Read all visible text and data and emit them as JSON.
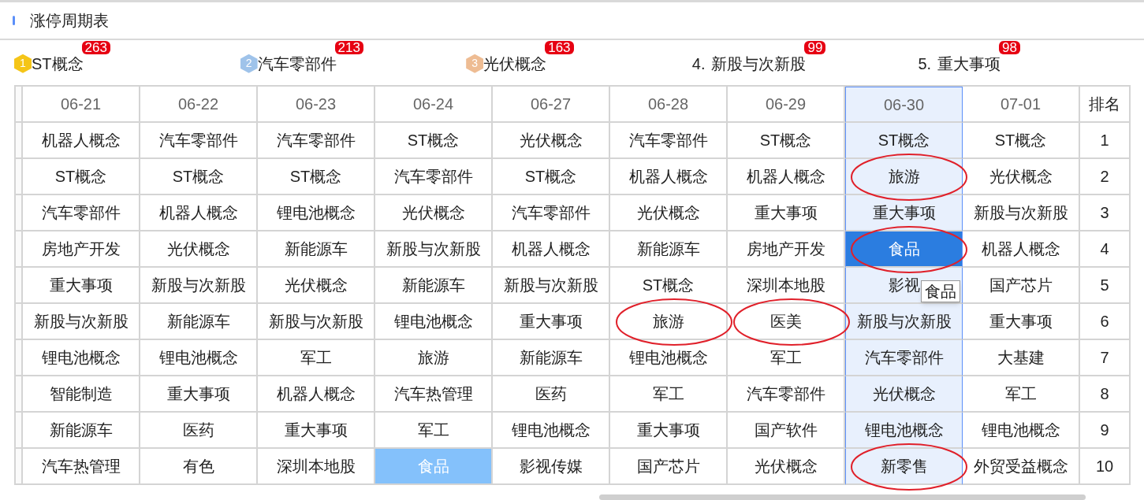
{
  "title": "涨停周期表",
  "legend": [
    {
      "kind": "medal",
      "rank": "1",
      "color": "#f5c518",
      "label": "ST概念",
      "count": "263"
    },
    {
      "kind": "medal",
      "rank": "2",
      "color": "#9fc3ea",
      "label": "汽车零部件",
      "count": "213"
    },
    {
      "kind": "medal",
      "rank": "3",
      "color": "#eebc93",
      "label": "光伏概念",
      "count": "163"
    },
    {
      "kind": "plain",
      "rank": "4.",
      "label": "新股与次新股",
      "count": "99"
    },
    {
      "kind": "plain",
      "rank": "5.",
      "label": "重大事项",
      "count": "98"
    }
  ],
  "table": {
    "columns": [
      {
        "label": "06-21",
        "selected": false
      },
      {
        "label": "06-22",
        "selected": false
      },
      {
        "label": "06-23",
        "selected": false
      },
      {
        "label": "06-24",
        "selected": false
      },
      {
        "label": "06-27",
        "selected": false
      },
      {
        "label": "06-28",
        "selected": false
      },
      {
        "label": "06-29",
        "selected": false
      },
      {
        "label": "06-30",
        "selected": true
      },
      {
        "label": "07-01",
        "selected": false
      }
    ],
    "rank_header": "排名",
    "rows": [
      {
        "rank": "1",
        "cells": [
          {
            "text": "机器人概念",
            "selected": false,
            "highlighted": false,
            "circled": false
          },
          {
            "text": "汽车零部件",
            "selected": false,
            "highlighted": false,
            "circled": false
          },
          {
            "text": "汽车零部件",
            "selected": false,
            "highlighted": false,
            "circled": false
          },
          {
            "text": "ST概念",
            "selected": false,
            "highlighted": false,
            "circled": false
          },
          {
            "text": "光伏概念",
            "selected": false,
            "highlighted": false,
            "circled": false
          },
          {
            "text": "汽车零部件",
            "selected": false,
            "highlighted": false,
            "circled": false
          },
          {
            "text": "ST概念",
            "selected": false,
            "highlighted": false,
            "circled": false
          },
          {
            "text": "ST概念",
            "selected": false,
            "highlighted": false,
            "circled": false
          },
          {
            "text": "ST概念",
            "selected": false,
            "highlighted": false,
            "circled": false
          }
        ]
      },
      {
        "rank": "2",
        "cells": [
          {
            "text": "ST概念",
            "selected": false,
            "highlighted": false,
            "circled": false
          },
          {
            "text": "ST概念",
            "selected": false,
            "highlighted": false,
            "circled": false
          },
          {
            "text": "ST概念",
            "selected": false,
            "highlighted": false,
            "circled": false
          },
          {
            "text": "汽车零部件",
            "selected": false,
            "highlighted": false,
            "circled": false
          },
          {
            "text": "ST概念",
            "selected": false,
            "highlighted": false,
            "circled": false
          },
          {
            "text": "机器人概念",
            "selected": false,
            "highlighted": false,
            "circled": false
          },
          {
            "text": "机器人概念",
            "selected": false,
            "highlighted": false,
            "circled": false
          },
          {
            "text": "旅游",
            "selected": false,
            "highlighted": false,
            "circled": true
          },
          {
            "text": "光伏概念",
            "selected": false,
            "highlighted": false,
            "circled": false
          }
        ]
      },
      {
        "rank": "3",
        "cells": [
          {
            "text": "汽车零部件",
            "selected": false,
            "highlighted": false,
            "circled": false
          },
          {
            "text": "机器人概念",
            "selected": false,
            "highlighted": false,
            "circled": false
          },
          {
            "text": "锂电池概念",
            "selected": false,
            "highlighted": false,
            "circled": false
          },
          {
            "text": "光伏概念",
            "selected": false,
            "highlighted": false,
            "circled": false
          },
          {
            "text": "汽车零部件",
            "selected": false,
            "highlighted": false,
            "circled": false
          },
          {
            "text": "光伏概念",
            "selected": false,
            "highlighted": false,
            "circled": false
          },
          {
            "text": "重大事项",
            "selected": false,
            "highlighted": false,
            "circled": false
          },
          {
            "text": "重大事项",
            "selected": false,
            "highlighted": false,
            "circled": false
          },
          {
            "text": "新股与次新股",
            "selected": false,
            "highlighted": false,
            "circled": false
          }
        ]
      },
      {
        "rank": "4",
        "cells": [
          {
            "text": "房地产开发",
            "selected": false,
            "highlighted": false,
            "circled": false
          },
          {
            "text": "光伏概念",
            "selected": false,
            "highlighted": false,
            "circled": false
          },
          {
            "text": "新能源车",
            "selected": false,
            "highlighted": false,
            "circled": false
          },
          {
            "text": "新股与次新股",
            "selected": false,
            "highlighted": false,
            "circled": false
          },
          {
            "text": "机器人概念",
            "selected": false,
            "highlighted": false,
            "circled": false
          },
          {
            "text": "新能源车",
            "selected": false,
            "highlighted": false,
            "circled": false
          },
          {
            "text": "房地产开发",
            "selected": false,
            "highlighted": false,
            "circled": false
          },
          {
            "text": "食品",
            "selected": true,
            "highlighted": false,
            "circled": true
          },
          {
            "text": "机器人概念",
            "selected": false,
            "highlighted": false,
            "circled": false
          }
        ]
      },
      {
        "rank": "5",
        "cells": [
          {
            "text": "重大事项",
            "selected": false,
            "highlighted": false,
            "circled": false
          },
          {
            "text": "新股与次新股",
            "selected": false,
            "highlighted": false,
            "circled": false
          },
          {
            "text": "光伏概念",
            "selected": false,
            "highlighted": false,
            "circled": false
          },
          {
            "text": "新能源车",
            "selected": false,
            "highlighted": false,
            "circled": false
          },
          {
            "text": "新股与次新股",
            "selected": false,
            "highlighted": false,
            "circled": false
          },
          {
            "text": "ST概念",
            "selected": false,
            "highlighted": false,
            "circled": false
          },
          {
            "text": "深圳本地股",
            "selected": false,
            "highlighted": false,
            "circled": false
          },
          {
            "text": "影视",
            "selected": false,
            "highlighted": false,
            "circled": false,
            "tooltip": "食品"
          },
          {
            "text": "国产芯片",
            "selected": false,
            "highlighted": false,
            "circled": false
          }
        ]
      },
      {
        "rank": "6",
        "cells": [
          {
            "text": "新股与次新股",
            "selected": false,
            "highlighted": false,
            "circled": false
          },
          {
            "text": "新能源车",
            "selected": false,
            "highlighted": false,
            "circled": false
          },
          {
            "text": "新股与次新股",
            "selected": false,
            "highlighted": false,
            "circled": false
          },
          {
            "text": "锂电池概念",
            "selected": false,
            "highlighted": false,
            "circled": false
          },
          {
            "text": "重大事项",
            "selected": false,
            "highlighted": false,
            "circled": false
          },
          {
            "text": "旅游",
            "selected": false,
            "highlighted": false,
            "circled": true
          },
          {
            "text": "医美",
            "selected": false,
            "highlighted": false,
            "circled": true
          },
          {
            "text": "新股与次新股",
            "selected": false,
            "highlighted": false,
            "circled": false
          },
          {
            "text": "重大事项",
            "selected": false,
            "highlighted": false,
            "circled": false
          }
        ]
      },
      {
        "rank": "7",
        "cells": [
          {
            "text": "锂电池概念",
            "selected": false,
            "highlighted": false,
            "circled": false
          },
          {
            "text": "锂电池概念",
            "selected": false,
            "highlighted": false,
            "circled": false
          },
          {
            "text": "军工",
            "selected": false,
            "highlighted": false,
            "circled": false
          },
          {
            "text": "旅游",
            "selected": false,
            "highlighted": false,
            "circled": false
          },
          {
            "text": "新能源车",
            "selected": false,
            "highlighted": false,
            "circled": false
          },
          {
            "text": "锂电池概念",
            "selected": false,
            "highlighted": false,
            "circled": false
          },
          {
            "text": "军工",
            "selected": false,
            "highlighted": false,
            "circled": false
          },
          {
            "text": "汽车零部件",
            "selected": false,
            "highlighted": false,
            "circled": false
          },
          {
            "text": "大基建",
            "selected": false,
            "highlighted": false,
            "circled": false
          }
        ]
      },
      {
        "rank": "8",
        "cells": [
          {
            "text": "智能制造",
            "selected": false,
            "highlighted": false,
            "circled": false
          },
          {
            "text": "重大事项",
            "selected": false,
            "highlighted": false,
            "circled": false
          },
          {
            "text": "机器人概念",
            "selected": false,
            "highlighted": false,
            "circled": false
          },
          {
            "text": "汽车热管理",
            "selected": false,
            "highlighted": false,
            "circled": false
          },
          {
            "text": "医药",
            "selected": false,
            "highlighted": false,
            "circled": false
          },
          {
            "text": "军工",
            "selected": false,
            "highlighted": false,
            "circled": false
          },
          {
            "text": "汽车零部件",
            "selected": false,
            "highlighted": false,
            "circled": false
          },
          {
            "text": "光伏概念",
            "selected": false,
            "highlighted": false,
            "circled": false
          },
          {
            "text": "军工",
            "selected": false,
            "highlighted": false,
            "circled": false
          }
        ]
      },
      {
        "rank": "9",
        "cells": [
          {
            "text": "新能源车",
            "selected": false,
            "highlighted": false,
            "circled": false
          },
          {
            "text": "医药",
            "selected": false,
            "highlighted": false,
            "circled": false
          },
          {
            "text": "重大事项",
            "selected": false,
            "highlighted": false,
            "circled": false
          },
          {
            "text": "军工",
            "selected": false,
            "highlighted": false,
            "circled": false
          },
          {
            "text": "锂电池概念",
            "selected": false,
            "highlighted": false,
            "circled": false
          },
          {
            "text": "重大事项",
            "selected": false,
            "highlighted": false,
            "circled": false
          },
          {
            "text": "国产软件",
            "selected": false,
            "highlighted": false,
            "circled": false
          },
          {
            "text": "锂电池概念",
            "selected": false,
            "highlighted": false,
            "circled": false
          },
          {
            "text": "锂电池概念",
            "selected": false,
            "highlighted": false,
            "circled": false
          }
        ]
      },
      {
        "rank": "10",
        "cells": [
          {
            "text": "汽车热管理",
            "selected": false,
            "highlighted": false,
            "circled": false
          },
          {
            "text": "有色",
            "selected": false,
            "highlighted": false,
            "circled": false
          },
          {
            "text": "深圳本地股",
            "selected": false,
            "highlighted": false,
            "circled": false
          },
          {
            "text": "食品",
            "selected": false,
            "highlighted": true,
            "circled": false
          },
          {
            "text": "影视传媒",
            "selected": false,
            "highlighted": false,
            "circled": false
          },
          {
            "text": "国产芯片",
            "selected": false,
            "highlighted": false,
            "circled": false
          },
          {
            "text": "光伏概念",
            "selected": false,
            "highlighted": false,
            "circled": false
          },
          {
            "text": "新零售",
            "selected": false,
            "highlighted": false,
            "circled": true
          },
          {
            "text": "外贸受益概念",
            "selected": false,
            "highlighted": false,
            "circled": false
          }
        ]
      }
    ]
  }
}
